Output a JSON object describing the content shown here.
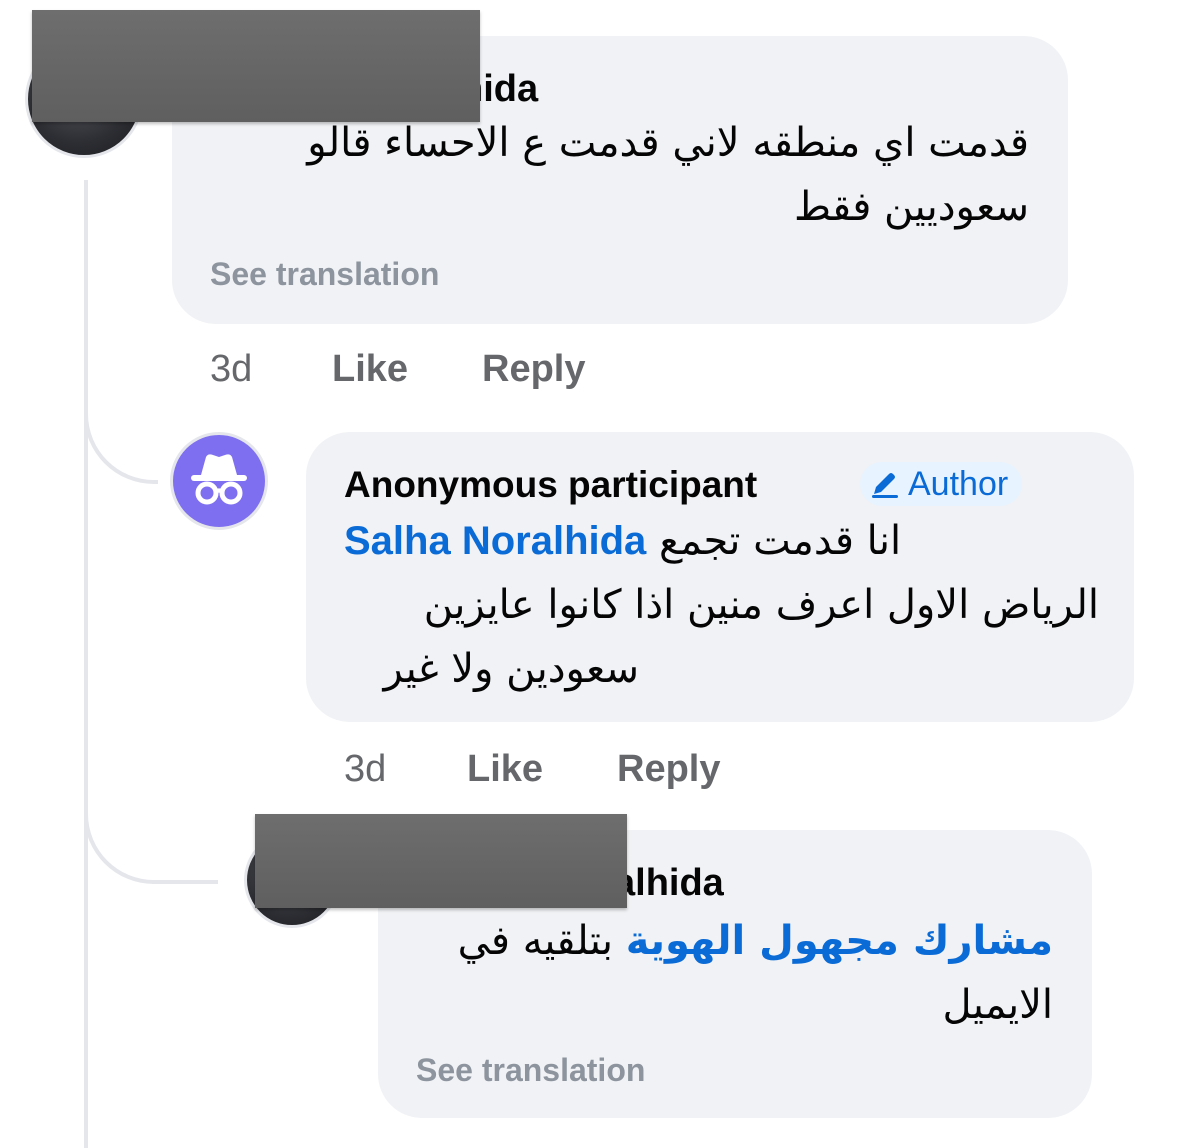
{
  "comments": [
    {
      "author": "hida",
      "text_lines": [
        "قدمت اي منطقه لاني قدمت ع الاحساء قالو",
        "سعوديين فقط"
      ],
      "see_translation": "See translation",
      "time": "3d",
      "like": "Like",
      "reply": "Reply"
    },
    {
      "author": "Anonymous participant",
      "badge": "Author",
      "mention": "Salha Noralhida",
      "text_lines": [
        "انا قدمت تجمع",
        "الرياض الاول اعرف منين اذا كانوا عايزين",
        "سعودين ولا غير"
      ],
      "time": "3d",
      "like": "Like",
      "reply": "Reply"
    },
    {
      "author": "alhida",
      "mention": "مشارك مجهول الهوية",
      "text_lines": [
        "بتلقيه في",
        "الايميل"
      ],
      "see_translation": "See translation"
    }
  ],
  "colors": {
    "bubble": "#f0f2f5",
    "link": "#0b6bd6",
    "muted": "#65676b",
    "anon_avatar": "#7e6ff0",
    "badge_bg": "#e7f3ff"
  },
  "icons": [
    "incognito-icon",
    "pencil-icon"
  ]
}
